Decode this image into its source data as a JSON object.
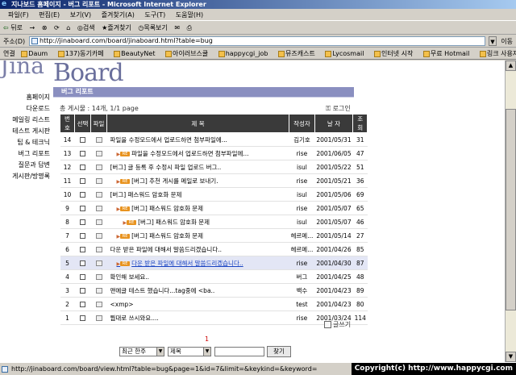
{
  "window": {
    "title": "지나보드 홈페이지 - 버그 리포트 - Microsoft Internet Explorer"
  },
  "menu": [
    "파일(F)",
    "편집(E)",
    "보기(V)",
    "즐겨찾기(A)",
    "도구(T)",
    "도움말(H)"
  ],
  "toolbar": {
    "back": "뒤로",
    "forward": "→",
    "stop": "⊗",
    "refresh": "⟳",
    "home": "⌂",
    "search": "검색",
    "favorites": "즐겨찾기",
    "history": "목록보기"
  },
  "address": {
    "label": "주소(D)",
    "url": "http://jinaboard.com/board/jinaboard.html?table=bug",
    "go": "이동"
  },
  "links": {
    "label": "연결",
    "items": [
      "Daum",
      "137)동기카페",
      "BeautyNet",
      "아이러브스쿨",
      "happycgi_job",
      "뮤즈캐스트",
      "Lycosmail",
      "인터넷 시작",
      "무료 Hotmail",
      "링크 사용자 정의"
    ]
  },
  "logo": {
    "top": "Jina",
    "board": "Board"
  },
  "sidebar": [
    "홈페이지",
    "다운로드",
    "메일링 리스트",
    "테스트 게시판",
    "팁 & 테크닉",
    "버그 리포트",
    "질문과 답변",
    "게시판/방명록"
  ],
  "board": {
    "section": "버그 리포트",
    "info": "총 게시물 : 14개, 1/1 page",
    "login": "로그인",
    "headers": [
      "번호",
      "선택",
      "파일",
      "제 목",
      "작성자",
      "날 자",
      "조회"
    ],
    "rows": [
      {
        "num": "14",
        "title": "파일을 수정모드에서 업로드하면 첨부파일에...",
        "author": "김기호",
        "date": "2001/05/31",
        "views": "31",
        "depth": 0,
        "hl": false
      },
      {
        "num": "13",
        "title": "파일을 수정모드에서 업로드하면 첨부파일에...",
        "author": "rise",
        "date": "2001/06/05",
        "views": "47",
        "depth": 1,
        "hl": false
      },
      {
        "num": "12",
        "title": "[버그] 글 등록 후 수정시 파일 업로드 버그..",
        "author": "isul",
        "date": "2001/05/22",
        "views": "51",
        "depth": 0,
        "hl": false
      },
      {
        "num": "11",
        "title": "[버그] 추천 게시를 메일로 보내기.",
        "author": "rise",
        "date": "2001/05/21",
        "views": "36",
        "depth": 1,
        "hl": false
      },
      {
        "num": "10",
        "title": "[버그] 패스워드 암호화 문제",
        "author": "isul",
        "date": "2001/05/06",
        "views": "69",
        "depth": 0,
        "hl": false
      },
      {
        "num": "9",
        "title": "[버그] 패스워드 암호화 문제",
        "author": "rise",
        "date": "2001/05/07",
        "views": "65",
        "depth": 1,
        "hl": false
      },
      {
        "num": "8",
        "title": "[버그] 패스워드 암호화 문제",
        "author": "isul",
        "date": "2001/05/07",
        "views": "46",
        "depth": 2,
        "hl": false
      },
      {
        "num": "7",
        "title": "[버그] 패스워드 암호화 문제",
        "author": "헤르메...",
        "date": "2001/05/14",
        "views": "27",
        "depth": 1,
        "hl": false
      },
      {
        "num": "6",
        "title": "다운 받은 파일에 대해서 말씀드리겠습니다..",
        "author": "헤르메...",
        "date": "2001/04/26",
        "views": "85",
        "depth": 0,
        "hl": false
      },
      {
        "num": "5",
        "title": "다운 받은 파일에 대해서 말씀드리겠습니다..",
        "author": "rise",
        "date": "2001/04/30",
        "views": "87",
        "depth": 1,
        "hl": true
      },
      {
        "num": "4",
        "title": "확인해 보세요..",
        "author": "버그",
        "date": "2001/04/25",
        "views": "48",
        "depth": 0,
        "hl": false
      },
      {
        "num": "3",
        "title": "맨에글 테스트 했습니다...tag중에 <ba..",
        "author": "백수",
        "date": "2001/04/23",
        "views": "89",
        "depth": 0,
        "hl": false
      },
      {
        "num": "2",
        "title": "<xmp>",
        "author": "test",
        "date": "2001/04/23",
        "views": "80",
        "depth": 0,
        "hl": false
      },
      {
        "num": "1",
        "title": "뭡대로 쓰시와요....",
        "author": "rise",
        "date": "2001/03/24",
        "views": "114",
        "depth": 0,
        "hl": false
      }
    ],
    "write": "글쓰기",
    "page": "1",
    "search": {
      "sort": "최근 한주",
      "field": "제목",
      "button": "찾기"
    }
  },
  "status": "http://jinaboard.com/board/view.html?table=bug&page=1&id=7&limit=&keykind=&keyword=",
  "copyright": "Copyright(c) http://www.happycgi.com"
}
